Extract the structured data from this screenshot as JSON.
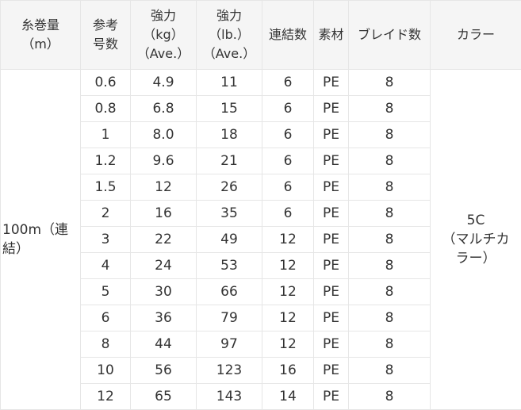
{
  "table": {
    "headers": [
      "糸巻量\n（m）",
      "参考\n号数",
      "強力\n（kg）\n（Ave.）",
      "強力\n（lb.）\n（Ave.）",
      "連結数",
      "素材",
      "ブレイド数",
      "カラー"
    ],
    "length": "100m（連\n結）",
    "color": "5C\n（マルチカ\nラー）",
    "rows": [
      {
        "size": "0.6",
        "kg": "4.9",
        "lb": "11",
        "links": "6",
        "material": "PE",
        "braid": "8"
      },
      {
        "size": "0.8",
        "kg": "6.8",
        "lb": "15",
        "links": "6",
        "material": "PE",
        "braid": "8"
      },
      {
        "size": "1",
        "kg": "8.0",
        "lb": "18",
        "links": "6",
        "material": "PE",
        "braid": "8"
      },
      {
        "size": "1.2",
        "kg": "9.6",
        "lb": "21",
        "links": "6",
        "material": "PE",
        "braid": "8"
      },
      {
        "size": "1.5",
        "kg": "12",
        "lb": "26",
        "links": "6",
        "material": "PE",
        "braid": "8"
      },
      {
        "size": "2",
        "kg": "16",
        "lb": "35",
        "links": "6",
        "material": "PE",
        "braid": "8"
      },
      {
        "size": "3",
        "kg": "22",
        "lb": "49",
        "links": "12",
        "material": "PE",
        "braid": "8"
      },
      {
        "size": "4",
        "kg": "24",
        "lb": "53",
        "links": "12",
        "material": "PE",
        "braid": "8"
      },
      {
        "size": "5",
        "kg": "30",
        "lb": "66",
        "links": "12",
        "material": "PE",
        "braid": "8"
      },
      {
        "size": "6",
        "kg": "36",
        "lb": "79",
        "links": "12",
        "material": "PE",
        "braid": "8"
      },
      {
        "size": "8",
        "kg": "44",
        "lb": "97",
        "links": "12",
        "material": "PE",
        "braid": "8"
      },
      {
        "size": "10",
        "kg": "56",
        "lb": "123",
        "links": "16",
        "material": "PE",
        "braid": "8"
      },
      {
        "size": "12",
        "kg": "65",
        "lb": "143",
        "links": "14",
        "material": "PE",
        "braid": "8"
      }
    ]
  }
}
